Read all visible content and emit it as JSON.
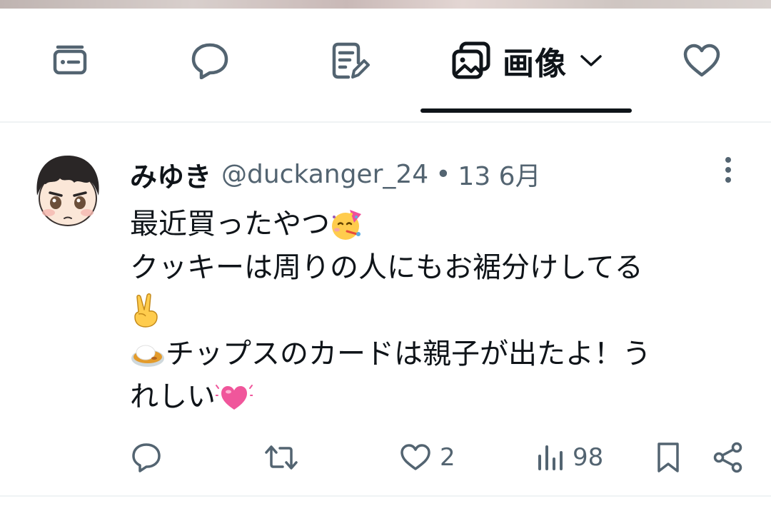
{
  "tabs": [
    {
      "name": "list-icon"
    },
    {
      "name": "reply-bubble-icon"
    },
    {
      "name": "article-icon"
    },
    {
      "name": "media-icon",
      "label": "画像",
      "selected": true
    },
    {
      "name": "heart-icon"
    }
  ],
  "post": {
    "display_name": "みゆき",
    "handle": "@duckanger_24",
    "separator": "•",
    "date": "13 6月",
    "lines": [
      {
        "text": "最近買ったやつ",
        "emoji": "partying-face-icon"
      },
      {
        "text": "クッキーは周りの人にもお裾分けしてる"
      },
      {
        "emoji": "victory-hand-icon"
      },
      {
        "emoji": "curry-rice-icon",
        "text": "チップスのカードは親子が出たよ！う"
      },
      {
        "text": "れしい",
        "emoji": "beating-heart-icon"
      }
    ],
    "actions": {
      "reply": {
        "icon": "reply-icon"
      },
      "repost": {
        "icon": "repost-icon"
      },
      "like": {
        "icon": "heart-icon",
        "count": "2"
      },
      "views": {
        "icon": "views-icon",
        "count": "98"
      },
      "bookmark": {
        "icon": "bookmark-icon"
      },
      "share": {
        "icon": "share-icon"
      }
    }
  },
  "colors": {
    "text": "#0f1419",
    "secondary": "#536471",
    "divider": "#eff3f4",
    "emoji_heart": "#f0569b"
  }
}
